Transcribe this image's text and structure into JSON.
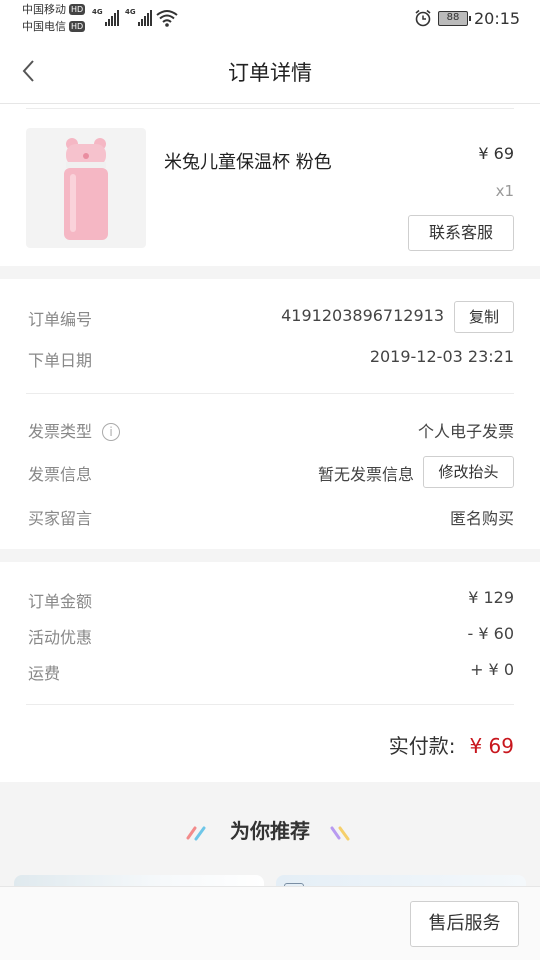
{
  "status_bar": {
    "carrier1": "中国移动",
    "carrier2": "中国电信",
    "hd": "HD",
    "network": "4G",
    "battery": "88",
    "time": "20:15"
  },
  "nav": {
    "title": "订单详情",
    "back_icon": "chevron-left-icon"
  },
  "product": {
    "name": "米兔儿童保温杯 粉色",
    "price": "¥ 69",
    "qty": "x1",
    "service_button": "联系客服"
  },
  "order_info": {
    "order_no_label": "订单编号",
    "order_no_value": "4191203896712913",
    "copy_button": "复制",
    "date_label": "下单日期",
    "date_value": "2019-12-03 23:21",
    "invoice_type_label": "发票类型",
    "invoice_type_value": "个人电子发票",
    "invoice_info_label": "发票信息",
    "invoice_info_value": "暂无发票信息",
    "edit_title_button": "修改抬头",
    "buyer_msg_label": "买家留言",
    "buyer_msg_value": "匿名购买",
    "info_icon_text": "i"
  },
  "amounts": {
    "order_amount_label": "订单金额",
    "order_amount_value": "¥ 129",
    "discount_label": "活动优惠",
    "discount_value": "- ¥ 60",
    "shipping_label": "运费",
    "shipping_value": "+ ¥ 0",
    "paid_label": "实付款:",
    "paid_value": "¥ 69"
  },
  "recommend": {
    "title": "为你推荐"
  },
  "bottom": {
    "after_sales_button": "售后服务"
  },
  "colors": {
    "accent_red": "#c8161d",
    "product_pink": "#f5b7c4"
  }
}
